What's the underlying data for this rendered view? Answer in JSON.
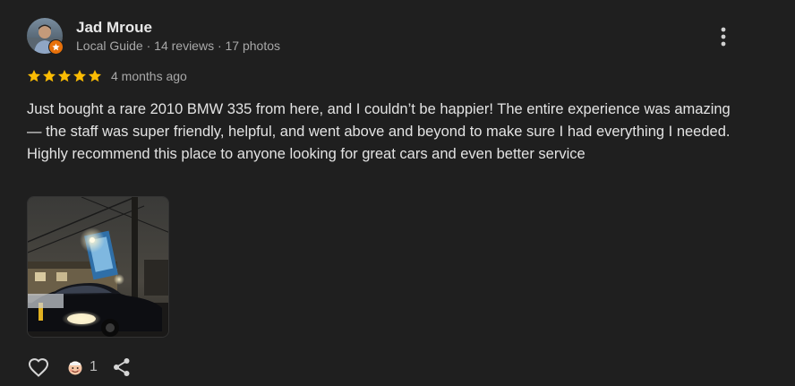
{
  "reviewer": {
    "name": "Jad Mroue",
    "meta": "Local Guide · 14 reviews · 17 photos",
    "badge_icon": "local-guide-badge-icon"
  },
  "review": {
    "rating": 5,
    "max_rating": 5,
    "date": "4 months ago",
    "text": "Just bought a rare 2010 BMW 335 from here, and I couldn’t be happier! The entire experience was amazing — the staff was super friendly, helpful, and went above and beyond to make sure I had everything I needed. Highly recommend this place to anyone looking for great cars and even better service"
  },
  "actions": {
    "reaction_count": "1",
    "like_icon": "heart-outline-icon",
    "reaction_icon": "reaction-emoji-icon",
    "share_icon": "share-icon",
    "more_icon": "more-vert-icon"
  },
  "colors": {
    "background": "#1f1f1f",
    "star": "#fbbc04",
    "badge": "#e8710a",
    "text": "#e3e3e3",
    "muted": "#a8a8a8"
  }
}
